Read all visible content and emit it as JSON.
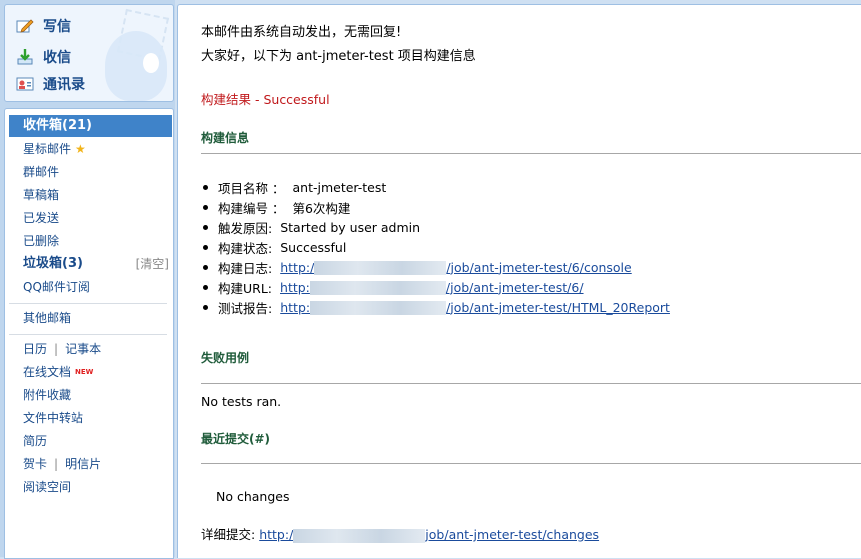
{
  "top": {
    "compose": "写信",
    "inbox": "收信",
    "contacts": "通讯录"
  },
  "folders": {
    "inbox": "收件箱(21)",
    "starred": "星标邮件",
    "group": "群邮件",
    "drafts": "草稿箱",
    "sent": "已发送",
    "deleted": "已删除",
    "junk": "垃圾箱(3)",
    "junk_clear": "[清空]",
    "subscribe": "QQ邮件订阅",
    "other": "其他邮箱",
    "calendar": "日历",
    "notes": "记事本",
    "docs": "在线文档",
    "docs_badge": "NEW",
    "attachments": "附件收藏",
    "transfer": "文件中转站",
    "resume": "简历",
    "cards": "贺卡",
    "postcards": "明信片",
    "reading": "阅读空间"
  },
  "mail": {
    "line1": "本邮件由系统自动发出，无需回复!",
    "line2": "大家好，以下为 ant-jmeter-test 项目构建信息",
    "result": "构建结果 - Successful",
    "build_info_title": "构建信息",
    "items": [
      {
        "label": "项目名称 ：",
        "value": "ant-jmeter-test"
      },
      {
        "label": "构建编号 ：",
        "value": "第6次构建"
      },
      {
        "label": "触发原因:",
        "value": "Started by user admin"
      },
      {
        "label": "构建状态:",
        "value": "Successful"
      },
      {
        "label": "构建日志:",
        "link_prefix": "http:/",
        "link_suffix": "/job/ant-jmeter-test/6/console"
      },
      {
        "label": "构建URL:",
        "link_prefix": "http:",
        "link_suffix": "/job/ant-jmeter-test/6/"
      },
      {
        "label": "测试报告:",
        "link_prefix": "http:",
        "link_suffix": "/job/ant-jmeter-test/HTML_20Report"
      }
    ],
    "failed_title": "失败用例",
    "failed_text": "No tests ran.",
    "recent_title": "最近提交(#)",
    "no_changes": "No changes",
    "detail_label": "详细提交:",
    "detail_link_prefix": "http:/",
    "detail_link_suffix": "job/ant-jmeter-test/changes"
  }
}
